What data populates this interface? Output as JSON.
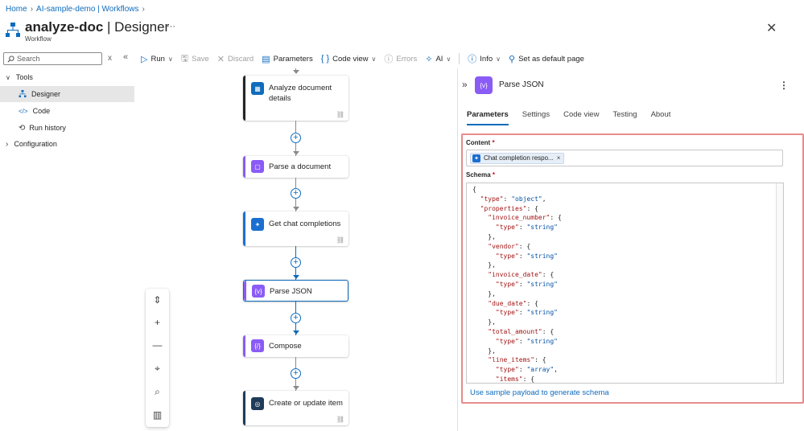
{
  "breadcrumb": [
    "Home",
    "AI-sample-demo | Workflows"
  ],
  "header": {
    "name": "analyze-doc",
    "view": "| Designer",
    "subtitle": "Workflow",
    "more": "···"
  },
  "search": {
    "placeholder": "Search"
  },
  "sidebar": {
    "items": [
      {
        "label": "Tools"
      },
      {
        "label": "Designer"
      },
      {
        "label": "Code"
      },
      {
        "label": "Run history"
      },
      {
        "label": "Configuration"
      }
    ]
  },
  "toolbar": {
    "run": "Run",
    "save": "Save",
    "discard": "Discard",
    "parameters": "Parameters",
    "code_view": "Code view",
    "errors": "Errors",
    "ai": "AI",
    "info": "Info",
    "default_page": "Set as default page"
  },
  "workflow": {
    "steps": [
      {
        "label": "Analyze document details",
        "color": "#0f6cbd"
      },
      {
        "label": "Parse a document",
        "color": "#8a5cf6"
      },
      {
        "label": "Get chat completions",
        "color": "#1b6fd1"
      },
      {
        "label": "Parse JSON",
        "color": "#8a5cf6"
      },
      {
        "label": "Compose",
        "color": "#8a5cf6"
      },
      {
        "label": "Create or update item",
        "color": "#1f3b5a"
      }
    ]
  },
  "panel": {
    "title": "Parse JSON",
    "tabs": [
      "Parameters",
      "Settings",
      "Code view",
      "Testing",
      "About"
    ],
    "content_label": "Content",
    "content_token": "Chat completion respo...",
    "schema_label": "Schema",
    "schema_text": "{\n  \"type\": \"object\",\n  \"properties\": {\n    \"invoice_number\": {\n      \"type\": \"string\"\n    },\n    \"vendor\": {\n      \"type\": \"string\"\n    },\n    \"invoice_date\": {\n      \"type\": \"string\"\n    },\n    \"due_date\": {\n      \"type\": \"string\"\n    },\n    \"total_amount\": {\n      \"type\": \"string\"\n    },\n    \"line_items\": {\n      \"type\": \"array\",\n      \"items\": {",
    "gen_link": "Use sample payload to generate schema"
  },
  "colors": {
    "accent": "#0f6cbd",
    "highlight": "#e88b8b"
  }
}
